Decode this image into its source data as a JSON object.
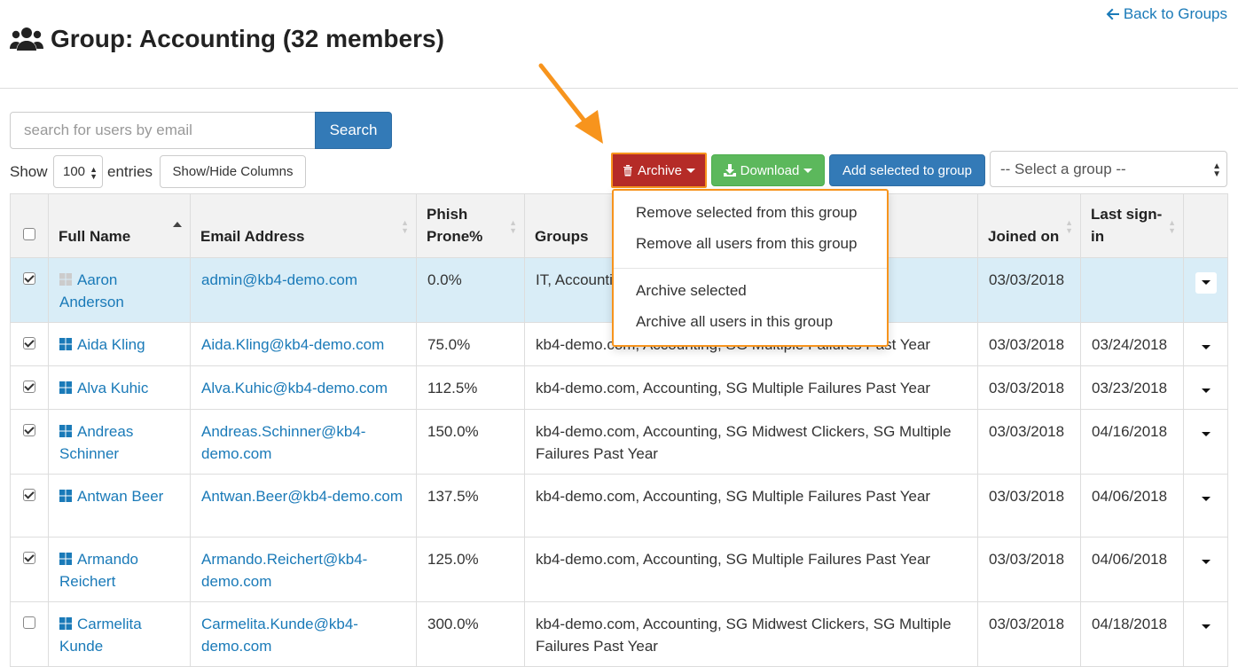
{
  "header": {
    "back_link": "Back to Groups",
    "title": "Group: Accounting (32 members)"
  },
  "search": {
    "placeholder": "search for users by email",
    "button": "Search"
  },
  "entries": {
    "show": "Show",
    "value": "100",
    "entries": "entries",
    "show_hide_columns": "Show/Hide Columns"
  },
  "toolbar": {
    "archive": "Archive",
    "download": "Download",
    "add_selected": "Add selected to group",
    "group_select": "-- Select a group --"
  },
  "archive_menu": {
    "items": [
      "Remove selected from this group",
      "Remove all users from this group",
      "Archive selected",
      "Archive all users in this group"
    ]
  },
  "table": {
    "columns": {
      "full_name": "Full Name",
      "email": "Email Address",
      "phish": "Phish Prone%",
      "groups": "Groups",
      "joined": "Joined on",
      "last_signin": "Last sign-in"
    },
    "rows": [
      {
        "checked": true,
        "selected": true,
        "icon_gray": true,
        "name": "Aaron Anderson",
        "email": "admin@kb4-demo.com",
        "phish": "0.0%",
        "groups": "IT, Accounting",
        "joined": "03/03/2018",
        "last": ""
      },
      {
        "checked": true,
        "selected": false,
        "icon_gray": false,
        "name": "Aida Kling",
        "email": "Aida.Kling@kb4-demo.com",
        "phish": "75.0%",
        "groups": "kb4-demo.com, Accounting, SG Multiple Failures Past Year",
        "joined": "03/03/2018",
        "last": "03/24/2018"
      },
      {
        "checked": true,
        "selected": false,
        "icon_gray": false,
        "name": "Alva Kuhic",
        "email": "Alva.Kuhic@kb4-demo.com",
        "phish": "112.5%",
        "groups": "kb4-demo.com, Accounting, SG Multiple Failures Past Year",
        "joined": "03/03/2018",
        "last": "03/23/2018"
      },
      {
        "checked": true,
        "selected": false,
        "icon_gray": false,
        "name": "Andreas Schinner",
        "email": "Andreas.Schinner@kb4-demo.com",
        "phish": "150.0%",
        "groups": "kb4-demo.com, Accounting, SG Midwest Clickers, SG Multiple Failures Past Year",
        "joined": "03/03/2018",
        "last": "04/16/2018"
      },
      {
        "checked": true,
        "selected": false,
        "icon_gray": false,
        "name": "Antwan Beer",
        "email": "Antwan.Beer@kb4-demo.com",
        "phish": "137.5%",
        "groups": "kb4-demo.com, Accounting, SG Multiple Failures Past Year",
        "joined": "03/03/2018",
        "last": "04/06/2018"
      },
      {
        "checked": true,
        "selected": false,
        "icon_gray": false,
        "name": "Armando Reichert",
        "email": "Armando.Reichert@kb4-demo.com",
        "phish": "125.0%",
        "groups": "kb4-demo.com, Accounting, SG Multiple Failures Past Year",
        "joined": "03/03/2018",
        "last": "04/06/2018"
      },
      {
        "checked": false,
        "selected": false,
        "icon_gray": false,
        "name": "Carmelita Kunde",
        "email": "Carmelita.Kunde@kb4-demo.com",
        "phish": "300.0%",
        "groups": "kb4-demo.com, Accounting, SG Midwest Clickers, SG Multiple Failures Past Year",
        "joined": "03/03/2018",
        "last": "04/18/2018"
      }
    ]
  },
  "colors": {
    "link": "#1a7ab8",
    "archive_bg": "#b52b27",
    "download_bg": "#5cb85c",
    "primary_bg": "#337ab7",
    "highlight_orange": "#f7941d",
    "selected_row_bg": "#d9edf7"
  }
}
